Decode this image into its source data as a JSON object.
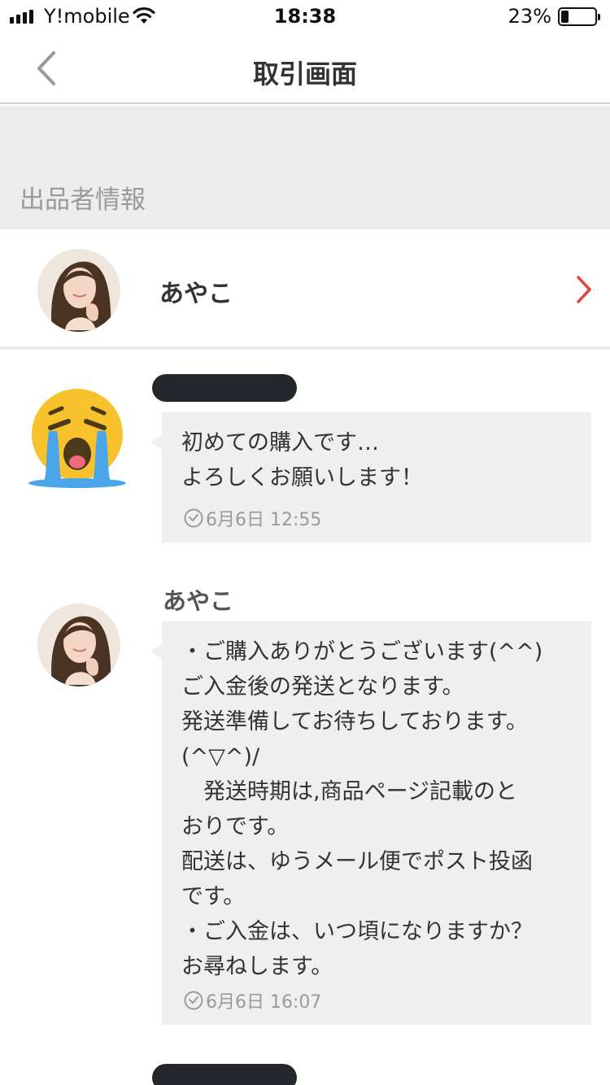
{
  "status_bar": {
    "carrier": "Y!mobile",
    "time": "18:38",
    "battery_percent": "23%",
    "battery_level": 0.23
  },
  "nav": {
    "title": "取引画面",
    "back_icon": "chevron-left-icon"
  },
  "seller_section": {
    "title": "出品者情報",
    "seller_name": "あやこ",
    "chevron_color": "#e0473c"
  },
  "messages": [
    {
      "sender": "",
      "avatar": "crying-face-emoji",
      "text": "初めての購入です…\nよろしくお願いします！",
      "time": "6月6日  12:55"
    },
    {
      "sender": "あやこ",
      "avatar": "seller-photo",
      "text": "・ご購入ありがとうございます(^^)\nご入金後の発送となります。\n発送準備してお待ちしております。\n(^▽^)/\n　発送時期は,商品ページ記載のと\nおりです。\n配送は、ゆうメール便でポスト投函\nです。\n・ご入金は、いつ頃になりますか？\nお尋ねします。",
      "time": "6月6日  16:07"
    }
  ]
}
